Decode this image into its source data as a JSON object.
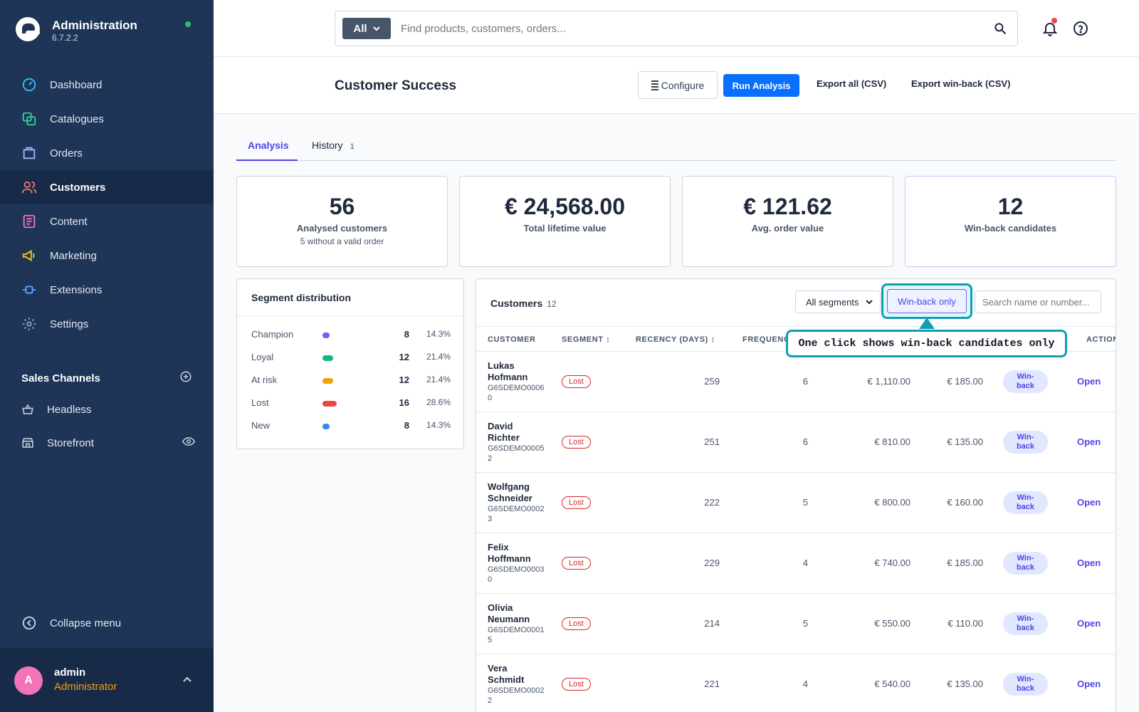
{
  "app": {
    "title": "Administration",
    "version": "6.7.2.2"
  },
  "nav": [
    {
      "label": "Dashboard",
      "icon": "dashboard-icon"
    },
    {
      "label": "Catalogues",
      "icon": "catalogue-icon"
    },
    {
      "label": "Orders",
      "icon": "orders-icon"
    },
    {
      "label": "Customers",
      "icon": "customers-icon",
      "active": true
    },
    {
      "label": "Content",
      "icon": "content-icon"
    },
    {
      "label": "Marketing",
      "icon": "marketing-icon"
    },
    {
      "label": "Extensions",
      "icon": "extensions-icon"
    },
    {
      "label": "Settings",
      "icon": "settings-icon"
    }
  ],
  "sales_channels": {
    "title": "Sales Channels",
    "items": [
      {
        "label": "Headless"
      },
      {
        "label": "Storefront"
      }
    ]
  },
  "collapse_label": "Collapse menu",
  "user": {
    "initial": "A",
    "name": "admin",
    "role": "Administrator"
  },
  "search": {
    "type": "All",
    "placeholder": "Find products, customers, orders..."
  },
  "page": {
    "title": "Customer Success",
    "configure": "Configure",
    "run": "Run Analysis",
    "export_all": "Export all (CSV)",
    "export_winback": "Export win-back (CSV)"
  },
  "tabs": [
    {
      "label": "Analysis"
    },
    {
      "label": "History",
      "count": "1"
    }
  ],
  "kpis": [
    {
      "value": "56",
      "label": "Analysed customers",
      "sub": "5 without a valid order"
    },
    {
      "value": "€ 24,568.00",
      "label": "Total lifetime value"
    },
    {
      "value": "€ 121.62",
      "label": "Avg. order value"
    },
    {
      "value": "12",
      "label": "Win-back candidates"
    }
  ],
  "segments": {
    "title": "Segment distribution",
    "rows": [
      {
        "name": "Champion",
        "count": "8",
        "pct": "14.3%",
        "fraction": 0.143,
        "color": "#6366f1"
      },
      {
        "name": "Loyal",
        "count": "12",
        "pct": "21.4%",
        "fraction": 0.214,
        "color": "#10b981"
      },
      {
        "name": "At risk",
        "count": "12",
        "pct": "21.4%",
        "fraction": 0.214,
        "color": "#f59e0b"
      },
      {
        "name": "Lost",
        "count": "16",
        "pct": "28.6%",
        "fraction": 0.286,
        "color": "#ef4444"
      },
      {
        "name": "New",
        "count": "8",
        "pct": "14.3%",
        "fraction": 0.143,
        "color": "#3b82f6"
      }
    ]
  },
  "customers": {
    "title": "Customers",
    "count": "12",
    "segment_filter": "All segments",
    "winback_toggle": "Win-back only",
    "search_placeholder": "Search name or number...",
    "columns": {
      "customer": "CUSTOMER",
      "segment": "SEGMENT ↕",
      "recency": "RECENCY (DAYS) ↕",
      "frequency": "FREQUENCY",
      "action": "ACTION"
    },
    "rows": [
      {
        "name": "Lukas Hofmann",
        "number": "G6SDEMO00060",
        "segment": "Lost",
        "recency": "259",
        "frequency": "6",
        "lifetime": "€ 1,110.00",
        "aov": "€ 185.00",
        "tag": "Win-back",
        "action": "Open"
      },
      {
        "name": "David Richter",
        "number": "G6SDEMO00052",
        "segment": "Lost",
        "recency": "251",
        "frequency": "6",
        "lifetime": "€ 810.00",
        "aov": "€ 135.00",
        "tag": "Win-back",
        "action": "Open"
      },
      {
        "name": "Wolfgang Schneider",
        "number": "G6SDEMO00023",
        "segment": "Lost",
        "recency": "222",
        "frequency": "5",
        "lifetime": "€ 800.00",
        "aov": "€ 160.00",
        "tag": "Win-back",
        "action": "Open"
      },
      {
        "name": "Felix Hoffmann",
        "number": "G6SDEMO00030",
        "segment": "Lost",
        "recency": "229",
        "frequency": "4",
        "lifetime": "€ 740.00",
        "aov": "€ 185.00",
        "tag": "Win-back",
        "action": "Open"
      },
      {
        "name": "Olivia Neumann",
        "number": "G6SDEMO00015",
        "segment": "Lost",
        "recency": "214",
        "frequency": "5",
        "lifetime": "€ 550.00",
        "aov": "€ 110.00",
        "tag": "Win-back",
        "action": "Open"
      },
      {
        "name": "Vera Schmidt",
        "number": "G6SDEMO00022",
        "segment": "Lost",
        "recency": "221",
        "frequency": "4",
        "lifetime": "€ 540.00",
        "aov": "€ 135.00",
        "tag": "Win-back",
        "action": "Open"
      }
    ]
  },
  "tooltip": "One click shows win-back candidates only"
}
